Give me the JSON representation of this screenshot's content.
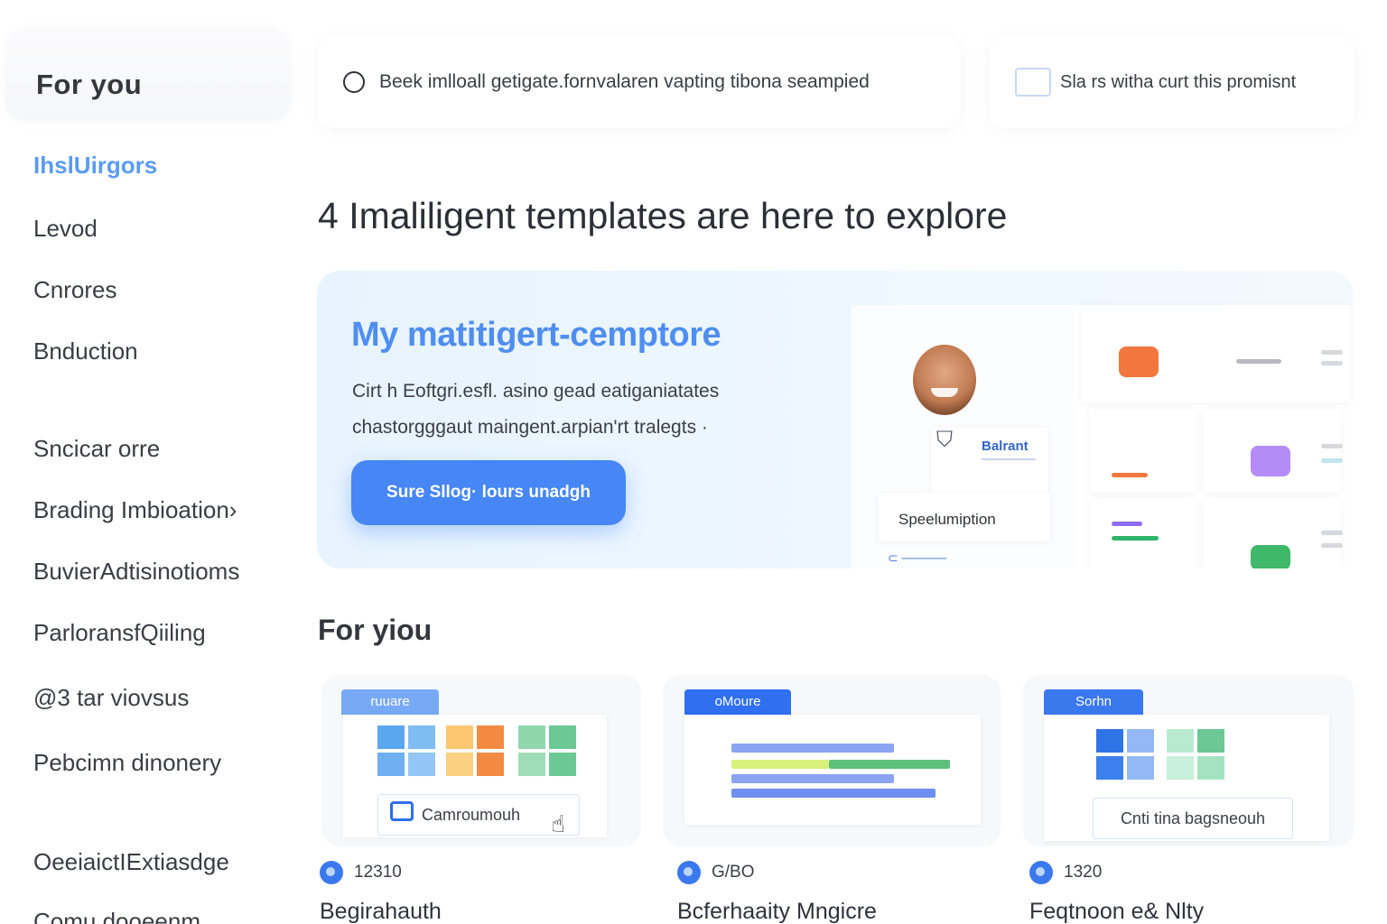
{
  "sidebar": {
    "title": "For you",
    "items": [
      {
        "label": "IhslUirgors",
        "active": true
      },
      {
        "label": "Levod"
      },
      {
        "label": "Cnrores"
      },
      {
        "label": "Bnduction"
      },
      {
        "label": "Sncicar orre"
      },
      {
        "label": "Brading Imbioation›"
      },
      {
        "label": "BuvierAdtisinotioms"
      },
      {
        "label": "ParloransfQiiling"
      },
      {
        "label": "@3 tar viovsus"
      },
      {
        "label": "Pebcimn dinonery"
      },
      {
        "label": "OeeiaictIExtiasdge"
      },
      {
        "label": "Comu dooeenm"
      }
    ]
  },
  "search": {
    "placeholder": "Beek imlloall getigate.fornvalaren vapting tibona seampied",
    "icon": "search-icon"
  },
  "promo": {
    "text": "Sla rs witha curt this promisnt"
  },
  "headline": "4 Imaliligent templates are here to explore",
  "hero": {
    "title": "My matitigert-cemptore",
    "description_line1": "Cirt h Eoftgri.esfl. asino gead eatiganiatates",
    "description_line2": "chastorgggaut maingent.arpian'rt tralegts ·",
    "button_label": "Sure Sllog· lours unadgh",
    "preview": {
      "brand_label": "Balrant",
      "spec_label": "Speelumiption"
    }
  },
  "section": {
    "title": "For yiou"
  },
  "cards": [
    {
      "tab": "ruuare",
      "chip": "Camroumouh",
      "meta": "12310",
      "title": "Begirahauth"
    },
    {
      "tab": "oMoure",
      "chip": "",
      "meta": "G/BO",
      "title": "Bcferhaaity Mngicre"
    },
    {
      "tab": "Sorhn",
      "chip": "Cnti tina bagsneouh",
      "meta": "1320",
      "title": "Feqtnoon e& Nlty"
    }
  ],
  "colors": {
    "accent": "#4686f5",
    "active_nav": "#5b9bf0",
    "hero_title": "#4f8ef0"
  }
}
